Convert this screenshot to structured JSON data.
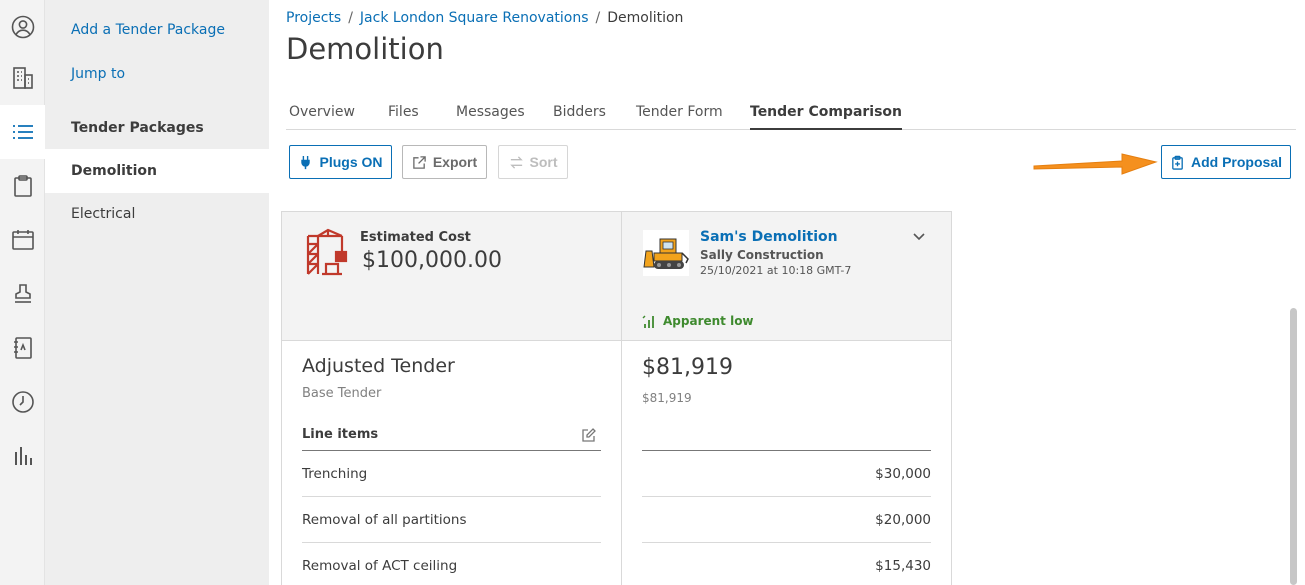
{
  "colors": {
    "accent": "#0a6fb5",
    "success": "#3e8a2e",
    "callout_arrow": "#f5901e"
  },
  "rail": {
    "icons": [
      "user-circle-icon",
      "building-icon",
      "list-icon",
      "clipboard-icon",
      "calendar-icon",
      "stamp-icon",
      "notebook-icon",
      "clock-icon",
      "bar-chart-icon"
    ]
  },
  "subnav": {
    "add_package": "Add a Tender Package",
    "jump_to": "Jump to",
    "section_title": "Tender Packages",
    "items": [
      "Demolition",
      "Electrical"
    ]
  },
  "breadcrumb": {
    "projects": "Projects",
    "project": "Jack London Square Renovations",
    "current": "Demolition"
  },
  "page_title": "Demolition",
  "tabs": [
    "Overview",
    "Files",
    "Messages",
    "Bidders",
    "Tender Form",
    "Tender Comparison"
  ],
  "toolbar": {
    "plugs": "Plugs ON",
    "export": "Export",
    "sort": "Sort",
    "add_proposal": "Add Proposal"
  },
  "estimate": {
    "label": "Estimated Cost",
    "value": "$100,000.00"
  },
  "bid": {
    "name": "Sam's Demolition",
    "company": "Sally Construction",
    "date": "25/10/2021 at 10:18 GMT-7",
    "badge": "Apparent low",
    "total": "$81,919",
    "total_sub": "$81,919"
  },
  "adjusted": {
    "title": "Adjusted Tender",
    "subtitle": "Base Tender",
    "line_items_header": "Line items"
  },
  "line_items": [
    {
      "name": "Trenching",
      "amount": "$30,000"
    },
    {
      "name": "Removal of all partitions",
      "amount": "$20,000"
    },
    {
      "name": "Removal of ACT ceiling",
      "amount": "$15,430"
    }
  ]
}
